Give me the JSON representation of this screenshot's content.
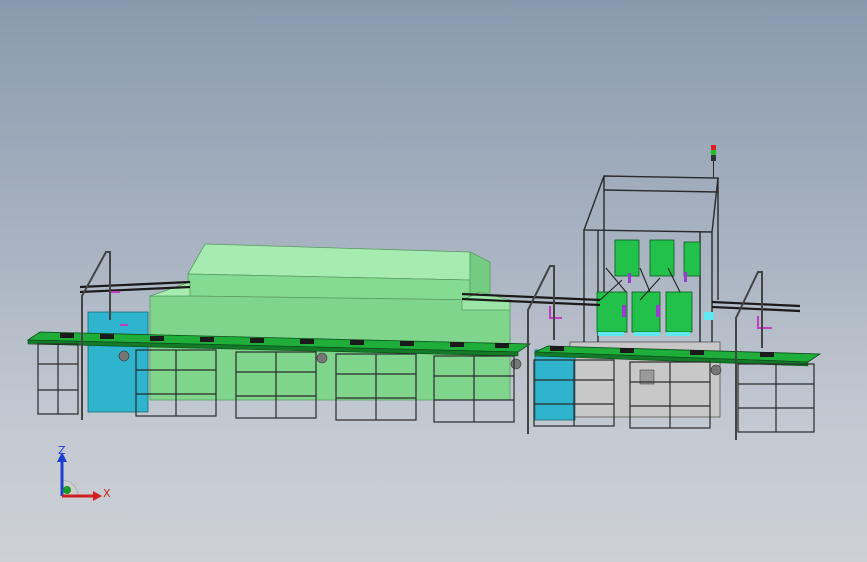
{
  "viewport": {
    "background_top": "#8a9aae",
    "background_bottom": "#cdd1d6"
  },
  "colors": {
    "oven_green": "#7ed58a",
    "conveyor_green": "#1fae3a",
    "cyan_panel": "#2eb4cc",
    "frame_gray": "#2a2a2a",
    "magenta_part": "#c03cc0",
    "robot_green": "#22c24a",
    "cabinet_gray": "#c8c8c8"
  },
  "triad": {
    "z_label": "Z",
    "x_label": "X",
    "z_color": "#1d3fcf",
    "x_color": "#d02020",
    "y_color": "#1a9a2a",
    "icon": "coordinate-triad-icon"
  },
  "status_light": {
    "icon": "stack-light-icon",
    "colors": [
      "#e02020",
      "#20c020",
      "#333333"
    ]
  }
}
